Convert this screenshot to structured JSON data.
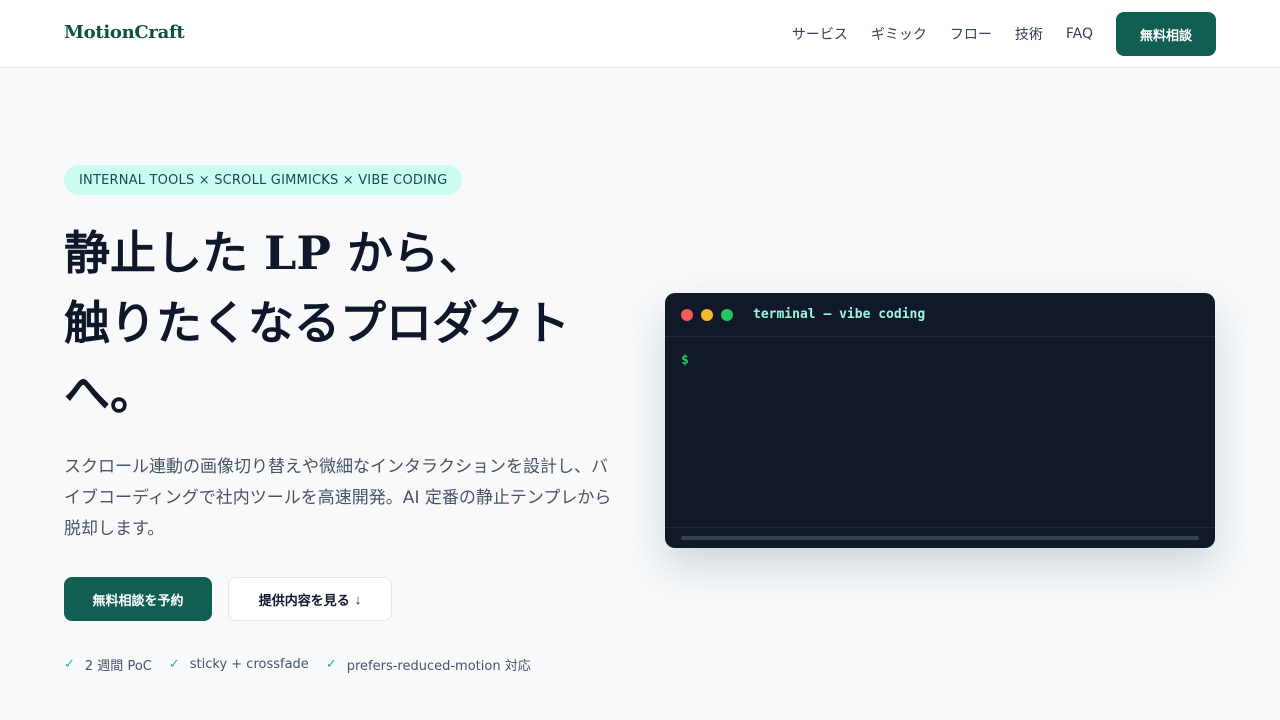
{
  "header": {
    "logo": "MotionCraft",
    "nav": [
      "サービス",
      "ギミック",
      "フロー",
      "技術",
      "FAQ"
    ],
    "cta": "無料相談"
  },
  "hero": {
    "badge": "INTERNAL TOOLS × SCROLL GIMMICKS × VIBE CODING",
    "headline_lines": [
      "静止した LP から、",
      "触りたくなるプロダクト",
      "へ。"
    ],
    "subtext": "スクロール連動の画像切り替えや微細なインタラクションを設計し、バイブコーディングで社内ツールを高速開発。AI 定番の静止テンプレから脱却します。",
    "primary_button": "無料相談を予約",
    "secondary_button": "提供内容を見る",
    "secondary_arrow": "↓",
    "features": [
      "2 週間 PoC",
      "sticky + crossfade",
      "prefers-reduced-motion 対応"
    ],
    "check_icon": "✓"
  },
  "terminal": {
    "title": "terminal — vibe coding",
    "prompt": "$",
    "dots": [
      "#f05a5a",
      "#f5b82e",
      "#22c55e"
    ]
  }
}
